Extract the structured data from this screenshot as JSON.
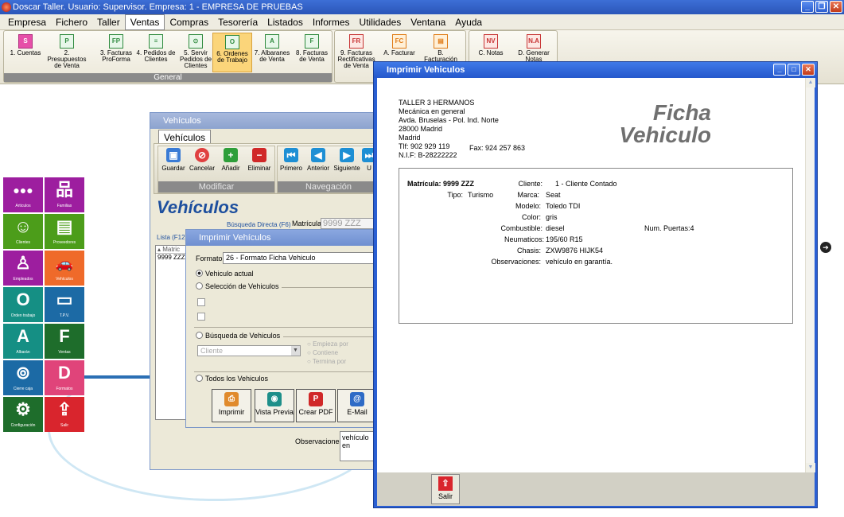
{
  "app": {
    "title": "Doscar Taller. Usuario: Supervisor. Empresa: 1 - EMPRESA DE PRUEBAS"
  },
  "menu": [
    "Empresa",
    "Fichero",
    "Taller",
    "Ventas",
    "Compras",
    "Tesorería",
    "Listados",
    "Informes",
    "Utilidades",
    "Ventana",
    "Ayuda"
  ],
  "ribbon": {
    "group_label": "General",
    "buttons": [
      {
        "label": "1. Cuentas",
        "icon": "S"
      },
      {
        "label": "2. Presupuestos de Venta",
        "icon": "P"
      },
      {
        "label": "3. Facturas ProForma",
        "icon": "FP"
      },
      {
        "label": "4. Pedidos de Clientes",
        "icon": "≡"
      },
      {
        "label": "5. Servir Pedidos de Clientes",
        "icon": "⊙"
      },
      {
        "label": "6. Ordenes de Trabajo",
        "icon": "O"
      },
      {
        "label": "7. Albaranes de Venta",
        "icon": "A"
      },
      {
        "label": "8. Facturas de Venta",
        "icon": "F"
      },
      {
        "label": "9. Facturas Rectificativas de Venta",
        "icon": "FR"
      },
      {
        "label": "A. Facturar",
        "icon": "FC"
      },
      {
        "label": "B. Facturación",
        "icon": "▤"
      },
      {
        "label": "C. Notas",
        "icon": "NV"
      },
      {
        "label": "D. Generar Notas",
        "icon": "N.A"
      }
    ]
  },
  "tiles": [
    {
      "label": "Articulos",
      "glyph": "●●●"
    },
    {
      "label": "Familias",
      "glyph": "品"
    },
    {
      "label": "Clientes",
      "glyph": "☺"
    },
    {
      "label": "Proveedores",
      "glyph": "▤"
    },
    {
      "label": "Empleados",
      "glyph": "♙"
    },
    {
      "label": "Vehículos",
      "glyph": "🚗"
    },
    {
      "label": "Orden trabajo",
      "glyph": "O"
    },
    {
      "label": "T.P.V.",
      "glyph": "▭"
    },
    {
      "label": "Albarán",
      "glyph": "A"
    },
    {
      "label": "Ventas",
      "glyph": "F"
    },
    {
      "label": "Cierre caja",
      "glyph": "⊚"
    },
    {
      "label": "Formatos",
      "glyph": "D"
    },
    {
      "label": "Configuración",
      "glyph": "⚙"
    },
    {
      "label": "Salir",
      "glyph": "⇪"
    }
  ],
  "vehiculos_window": {
    "title": "Vehículos",
    "tab": "Vehículos",
    "toolbar": {
      "buttons": [
        "Guardar",
        "Cancelar",
        "Añadir",
        "Eliminar",
        "Primero",
        "Anterior",
        "Siguiente",
        "U"
      ],
      "groups": [
        "Modificar",
        "Navegación"
      ]
    },
    "heading": "Vehículos",
    "search_label": "Búsqueda Directa (F6)",
    "matricula_label": "Matrícula:",
    "matricula_value": "9999 ZZZ",
    "list_label": "Lista (F12)",
    "list_header": "Matric",
    "list_rows": [
      "9999 ZZZ"
    ],
    "obs_label": "Observaciones:",
    "obs_value": "vehículo en"
  },
  "print_dialog": {
    "title": "Imprimir Vehículos",
    "format_label": "Formato:",
    "format_value": "26 - Formato Ficha Vehiculo",
    "opt_actual": "Vehiculo actual",
    "opt_seleccion": "Selección de Vehiculos",
    "opt_busqueda": "Búsqueda de Vehiculos",
    "combo_value": "Cliente",
    "empieza": "Empieza por",
    "contiene": "Contiene",
    "termina": "Termina por",
    "opt_todos": "Todos los Vehiculos",
    "buttons": [
      "Imprimir",
      "Vista Previa",
      "Crear PDF",
      "E-Mail"
    ]
  },
  "preview_window": {
    "title": "Imprimir Vehiculos",
    "company": [
      "TALLER 3 HERMANOS",
      "Mecánica en general",
      "Avda. Bruselas - Pol. Ind. Norte",
      "28000    Madrid",
      "Madrid",
      "Tlf:  902 929 119",
      "N.I.F:     B-28222222"
    ],
    "fax": "Fax:   924 257 863",
    "doc_title_1": "Ficha",
    "doc_title_2": "Vehiculo",
    "matricula": "Matrícula: 9999 ZZZ",
    "tipo_label": "Tipo:",
    "tipo_value": "Turismo",
    "fields": [
      {
        "label": "Cliente:",
        "value": "1  -  Cliente Contado"
      },
      {
        "label": "Marca:",
        "value": "Seat"
      },
      {
        "label": "Modelo:",
        "value": "Toledo TDI"
      },
      {
        "label": "Color:",
        "value": "gris"
      },
      {
        "label": "Combustible:",
        "value": "diesel"
      },
      {
        "label": "Neumaticos:",
        "value": "195/60 R15"
      },
      {
        "label": "Chasis:",
        "value": "ZXW9876 HIJK54"
      },
      {
        "label": "Observaciones:",
        "value": "vehículo en garantía."
      }
    ],
    "puertas": "Num. Puertas:4",
    "salir": "Salir"
  }
}
